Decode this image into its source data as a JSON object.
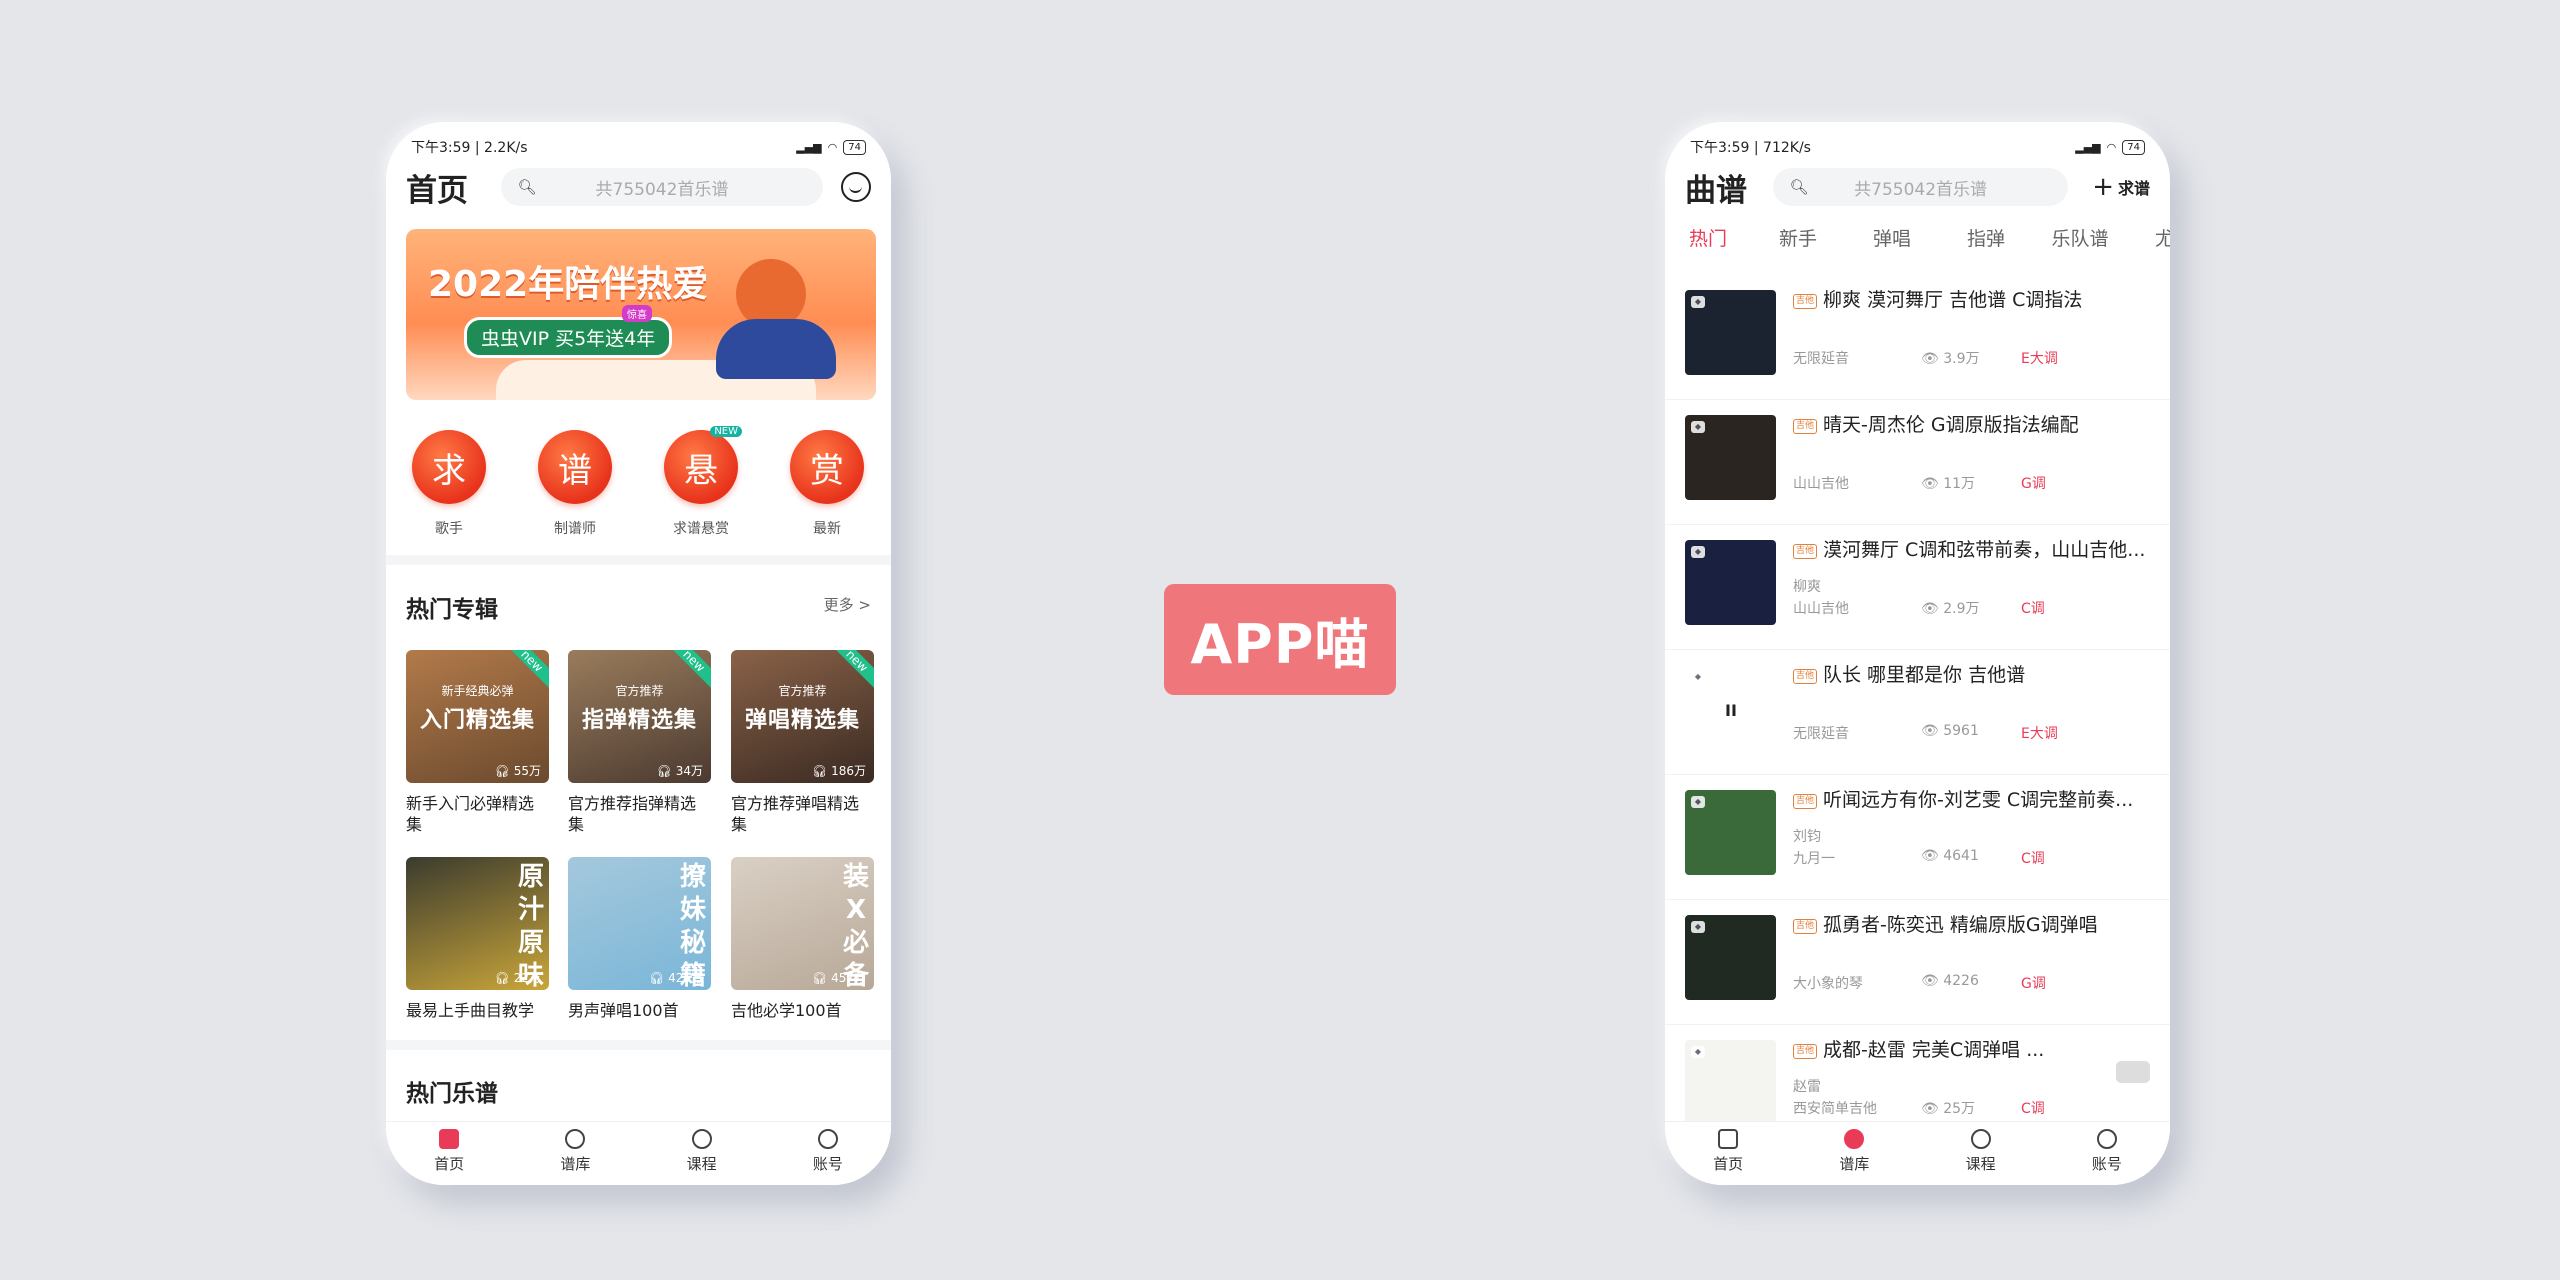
{
  "left_phone": {
    "status": {
      "time": "下午3:59 | 2.2K/s",
      "battery": "74"
    },
    "title": "首页",
    "search_placeholder": "共755042首乐谱",
    "banner": {
      "headline": "2022年陪伴热爱",
      "promo": "虫虫VIP  买5年送4年",
      "tag": "惊喜"
    },
    "quick_icons": [
      {
        "glyph": "求",
        "label": "歌手",
        "new": ""
      },
      {
        "glyph": "谱",
        "label": "制谱师",
        "new": ""
      },
      {
        "glyph": "悬",
        "label": "求谱悬赏",
        "new": "NEW"
      },
      {
        "glyph": "赏",
        "label": "最新",
        "new": ""
      }
    ],
    "albums_section": {
      "title": "热门专辑",
      "more": "更多 >"
    },
    "albums": [
      {
        "sub": "新手经典必弹",
        "main": "入门精选集",
        "count": "55万",
        "badge": "new",
        "caption": "新手入门必弹精选集",
        "color1": "#6b4a2e",
        "color2": "#b27a4a",
        "vertical": ""
      },
      {
        "sub": "官方推荐",
        "main": "指弹精选集",
        "count": "34万",
        "badge": "new",
        "caption": "官方推荐指弹精选集",
        "color1": "#4b3a30",
        "color2": "#9a7c5c",
        "vertical": ""
      },
      {
        "sub": "官方推荐",
        "main": "弹唱精选集",
        "count": "186万",
        "badge": "new",
        "caption": "官方推荐弹唱精选集",
        "color1": "#3a2a22",
        "color2": "#8a6248",
        "vertical": ""
      },
      {
        "sub": "",
        "main": "",
        "count": "22万",
        "badge": "",
        "caption": "最易上手曲目教学",
        "color1": "#caa63a",
        "color2": "#3b3b2e",
        "vertical": "原汁原味"
      },
      {
        "sub": "",
        "main": "",
        "count": "426万",
        "badge": "",
        "caption": "男声弹唱100首",
        "color1": "#7ab6d8",
        "color2": "#a4c8dc",
        "vertical": "撩妹秘籍"
      },
      {
        "sub": "",
        "main": "",
        "count": "457万",
        "badge": "",
        "caption": "吉他必学100首",
        "color1": "#b8a898",
        "color2": "#d9d0c4",
        "vertical": "装X必备"
      }
    ],
    "hot_scores_title": "热门乐谱",
    "tabbar": [
      {
        "label": "首页",
        "active": true
      },
      {
        "label": "谱库",
        "active": false
      },
      {
        "label": "课程",
        "active": false
      },
      {
        "label": "账号",
        "active": false
      }
    ]
  },
  "center_label": "APP喵",
  "right_phone": {
    "status": {
      "time": "下午3:59 | 712K/s",
      "battery": "74"
    },
    "title": "曲谱",
    "search_placeholder": "共755042首乐谱",
    "add_label": "求谱",
    "tabs": [
      "热门",
      "新手",
      "弹唱",
      "指弹",
      "乐队谱",
      "尤克"
    ],
    "badge_text": "吉他",
    "songs": [
      {
        "title": "柳爽 漠河舞厅 吉他谱 C调指法",
        "singer": "",
        "author": "无限延音",
        "views": "3.9万",
        "key": "E大调",
        "thumb": "#1b2230"
      },
      {
        "title": "晴天-周杰伦 G调原版指法编配",
        "singer": "",
        "author": "山山吉他",
        "views": "11万",
        "key": "G调",
        "thumb": "#2a2520"
      },
      {
        "title": "漠河舞厅 C调和弦带前奏，山山吉他...",
        "singer": "柳爽",
        "author": "山山吉他",
        "views": "2.9万",
        "key": "C调",
        "thumb": "#1a2040"
      },
      {
        "title": "队长 哪里都是你 吉他谱",
        "singer": "",
        "author": "无限延音",
        "views": "5961",
        "key": "E大调",
        "thumb": "#ffffff"
      },
      {
        "title": "听闻远方有你-刘艺雯 C调完整前奏...",
        "singer": "刘钧",
        "author": "九月一",
        "views": "4641",
        "key": "C调",
        "thumb": "#3a6a3a"
      },
      {
        "title": "孤勇者-陈奕迅 精编原版G调弹唱",
        "singer": "",
        "author": "大小象的琴",
        "views": "4226",
        "key": "G调",
        "thumb": "#202a22"
      },
      {
        "title": "成都-赵雷 完美C调弹唱 ...",
        "singer": "赵雷",
        "author": "西安简单吉他",
        "views": "25万",
        "key": "C调",
        "thumb": "#f4f4f0"
      }
    ],
    "pause_glyph": "II",
    "tabbar": [
      {
        "label": "首页",
        "active": false
      },
      {
        "label": "谱库",
        "active": true
      },
      {
        "label": "课程",
        "active": false
      },
      {
        "label": "账号",
        "active": false
      }
    ]
  }
}
